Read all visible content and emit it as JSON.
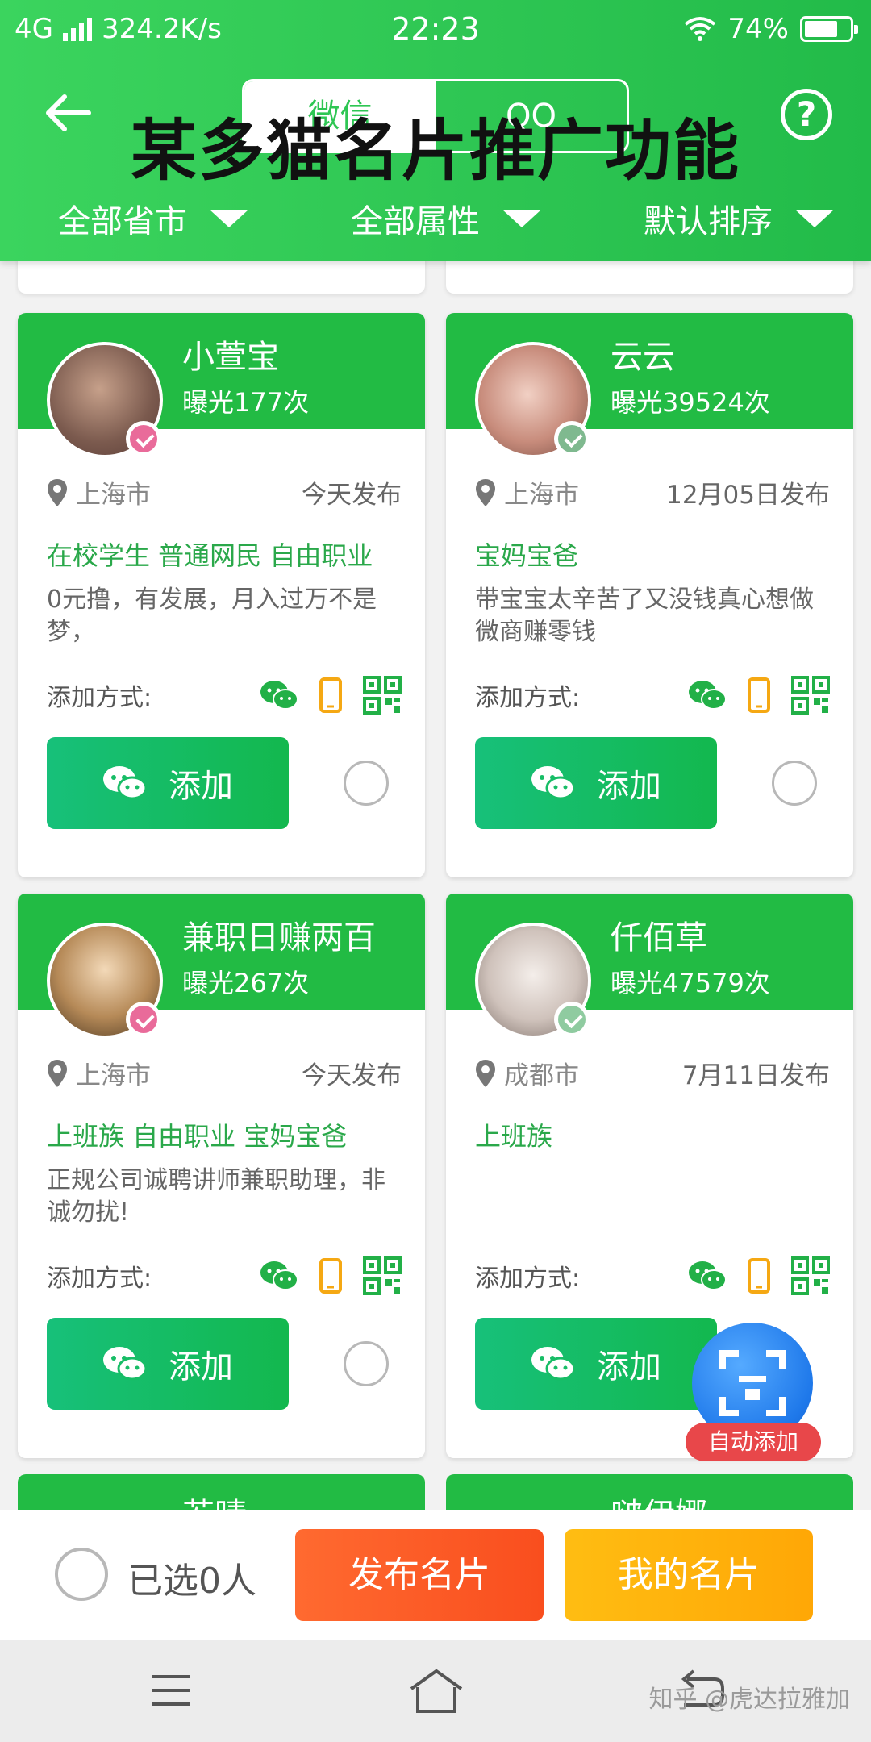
{
  "status_bar": {
    "network": "4G",
    "speed": "324.2K/s",
    "time": "22:23",
    "battery_percent": "74%",
    "battery_level": 0.74
  },
  "header": {
    "overlay_title": "某多猫名片推广功能",
    "tabs": [
      {
        "label": "微信",
        "active": true
      },
      {
        "label": "QQ",
        "active": false
      }
    ],
    "filters": [
      {
        "label": "全部省市"
      },
      {
        "label": "全部属性"
      },
      {
        "label": "默认排序"
      }
    ]
  },
  "cards": [
    {
      "name": "小萱宝",
      "exposure": "曝光177次",
      "location": "上海市",
      "published": "今天发布",
      "tags": "在校学生 普通网民 自由职业",
      "desc": "0元撸，有发展，月入过万不是梦，",
      "method_label": "添加方式:",
      "add_label": "添加"
    },
    {
      "name": "云云",
      "exposure": "曝光39524次",
      "location": "上海市",
      "published": "12月05日发布",
      "tags": "宝妈宝爸",
      "desc": "带宝宝太辛苦了又没钱真心想做微商赚零钱",
      "method_label": "添加方式:",
      "add_label": "添加"
    },
    {
      "name": "兼职日赚两百",
      "exposure": "曝光267次",
      "location": "上海市",
      "published": "今天发布",
      "tags": "上班族 自由职业 宝妈宝爸",
      "desc": "正规公司诚聘讲师兼职助理，非诚勿扰!",
      "method_label": "添加方式:",
      "add_label": "添加"
    },
    {
      "name": "仟佰草",
      "exposure": "曝光47579次",
      "location": "成都市",
      "published": "7月11日发布",
      "tags": "上班族",
      "desc": "",
      "method_label": "添加方式:",
      "add_label": "添加"
    }
  ],
  "next_cards": [
    {
      "name": "若晴"
    },
    {
      "name": "啵伊娜"
    }
  ],
  "fab": {
    "label": "自动添加"
  },
  "bottom_bar": {
    "selected_text": "已选0人",
    "publish_label": "发布名片",
    "mine_label": "我的名片"
  },
  "watermark": "知乎 @虎达拉雅加",
  "colors": {
    "primary_green": "#22bb44",
    "publish_orange": "#f95a22",
    "mine_yellow": "#ffb00a",
    "tag_green": "#2aa84a"
  }
}
